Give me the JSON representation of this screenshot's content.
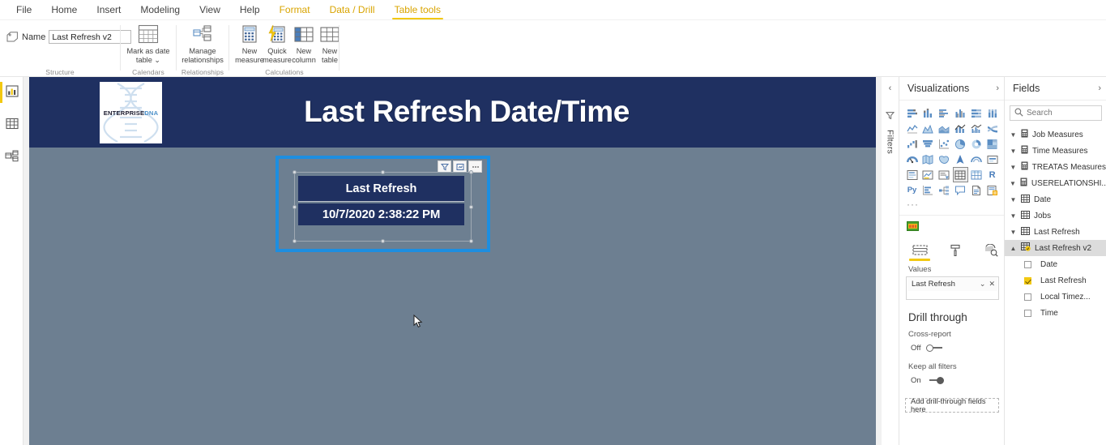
{
  "ribbon": {
    "tabs": [
      {
        "label": "File",
        "state": "normal"
      },
      {
        "label": "Home",
        "state": "normal"
      },
      {
        "label": "Insert",
        "state": "normal"
      },
      {
        "label": "Modeling",
        "state": "normal"
      },
      {
        "label": "View",
        "state": "normal"
      },
      {
        "label": "Help",
        "state": "normal"
      },
      {
        "label": "Format",
        "state": "accent"
      },
      {
        "label": "Data / Drill",
        "state": "accent"
      },
      {
        "label": "Table tools",
        "state": "active"
      }
    ],
    "name_label": "Name",
    "name_value": "Last Refresh v2",
    "groups": [
      {
        "label": "Structure"
      },
      {
        "label": "Calendars"
      },
      {
        "label": "Relationships"
      },
      {
        "label": "Calculations"
      }
    ],
    "buttons": {
      "mark_as_date_table": "Mark as date\ntable",
      "mark_as_date_table_l1": "Mark as date",
      "mark_as_date_table_l2": "table ⌄",
      "manage_relationships_l1": "Manage",
      "manage_relationships_l2": "relationships",
      "new_measure_l1": "New",
      "new_measure_l2": "measure",
      "quick_measure_l1": "Quick",
      "quick_measure_l2": "measure",
      "new_column_l1": "New",
      "new_column_l2": "column",
      "new_table_l1": "New",
      "new_table_l2": "table"
    }
  },
  "left_rail": {
    "items": [
      {
        "name": "report-view",
        "active": true
      },
      {
        "name": "data-view",
        "active": false
      },
      {
        "name": "model-view",
        "active": false
      }
    ]
  },
  "report": {
    "banner_title": "Last Refresh Date/Time",
    "logo_primary": "ENTERPRISE",
    "logo_secondary": "DNA",
    "banner_color": "#1f3061",
    "canvas_color": "#6d7f91",
    "selection_color": "#1d8ee0",
    "visual": {
      "header_icons": [
        "filter-icon",
        "focus-mode-icon",
        "more-options-icon"
      ],
      "column_header": "Last Refresh",
      "cell_value": "10/7/2020 2:38:22 PM"
    }
  },
  "filters_pane": {
    "label": "Filters"
  },
  "visualizations": {
    "title": "Visualizations",
    "selected_visual": "table-visual",
    "more_glyph": "···",
    "format_tabs": [
      {
        "name": "fields-tab",
        "active": true
      },
      {
        "name": "format-tab",
        "active": false
      },
      {
        "name": "analytics-tab",
        "active": false
      }
    ],
    "well_label": "Values",
    "well_chip": "Last Refresh",
    "drill": {
      "title": "Drill through",
      "cross_report_label": "Cross-report",
      "cross_report_state": "Off",
      "keep_all_filters_label": "Keep all filters",
      "keep_all_filters_state": "On",
      "drop_zone": "Add drill-through fields here"
    }
  },
  "fields": {
    "title": "Fields",
    "search_placeholder": "Search",
    "tables": [
      {
        "label": "Job Measures",
        "icon": "measure-table-icon",
        "expanded": false,
        "highlight": false
      },
      {
        "label": "Time Measures",
        "icon": "measure-table-icon",
        "expanded": false,
        "highlight": false
      },
      {
        "label": "TREATAS Measures",
        "icon": "measure-table-icon",
        "expanded": false,
        "highlight": false
      },
      {
        "label": "USERELATIONSHI...",
        "icon": "measure-table-icon",
        "expanded": false,
        "highlight": false
      },
      {
        "label": "Date",
        "icon": "table-icon",
        "expanded": false,
        "highlight": false
      },
      {
        "label": "Jobs",
        "icon": "table-icon",
        "expanded": false,
        "highlight": false
      },
      {
        "label": "Last Refresh",
        "icon": "table-icon",
        "expanded": false,
        "highlight": false
      },
      {
        "label": "Last Refresh v2",
        "icon": "table-calc-icon",
        "expanded": true,
        "highlight": true
      }
    ],
    "children": [
      {
        "label": "Date",
        "checked": false
      },
      {
        "label": "Last Refresh",
        "checked": true
      },
      {
        "label": "Local Timez...",
        "checked": false
      },
      {
        "label": "Time",
        "checked": false
      }
    ]
  }
}
